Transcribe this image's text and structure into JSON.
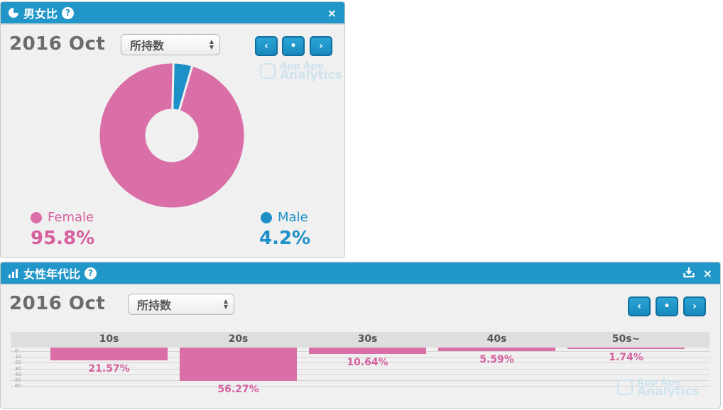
{
  "gender_panel": {
    "title": "男女比",
    "help": "?",
    "close": "×",
    "date": "2016 Oct",
    "select_value": "所持数",
    "nav": {
      "prev": "‹",
      "current": "•",
      "next": "›"
    },
    "watermark": {
      "line1": "App Ape",
      "line2": "Analytics"
    },
    "female": {
      "label": "Female",
      "value": "95.8%",
      "color": "#da6fa8"
    },
    "male": {
      "label": "Male",
      "value": "4.2%",
      "color": "#1e90c8"
    }
  },
  "age_panel": {
    "title": "女性年代比",
    "help": "?",
    "close": "×",
    "date": "2016 Oct",
    "select_value": "所持数",
    "nav": {
      "prev": "‹",
      "current": "•",
      "next": "›"
    },
    "watermark": {
      "line1": "App Ape",
      "line2": "Analytics"
    },
    "y_ticks": [
      "0",
      "10",
      "20",
      "30",
      "40",
      "50",
      "60"
    ]
  },
  "chart_data": [
    {
      "type": "pie",
      "title": "",
      "categories": [
        "Female",
        "Male"
      ],
      "values": [
        95.8,
        4.2
      ],
      "colors": [
        "#da6fa8",
        "#1e90c8"
      ],
      "donut": true
    },
    {
      "type": "bar",
      "title": "",
      "categories": [
        "10s",
        "20s",
        "30s",
        "40s",
        "50s~"
      ],
      "values": [
        21.57,
        56.27,
        10.64,
        5.59,
        1.74
      ],
      "labels": [
        "21.57%",
        "56.27%",
        "10.64%",
        "5.59%",
        "1.74%"
      ],
      "ylim": [
        0,
        60
      ],
      "orientation": "downward",
      "color": "#da6fa8"
    }
  ]
}
